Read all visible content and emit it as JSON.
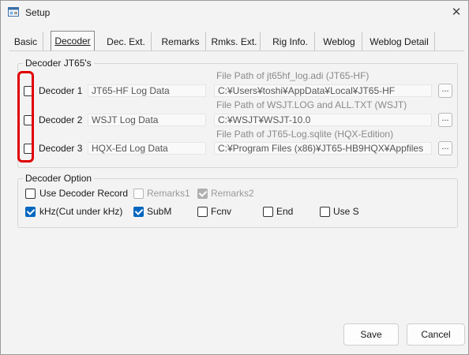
{
  "window": {
    "title": "Setup",
    "app_icon": "setup-window-icon",
    "close_icon": "close-icon",
    "close_glyph": "✕"
  },
  "tabs": [
    {
      "label": "Basic",
      "active": false
    },
    {
      "label": "Decoder",
      "active": true
    },
    {
      "label": "Dec. Ext.",
      "active": false
    },
    {
      "label": "Remarks",
      "active": false
    },
    {
      "label": "Rmks. Ext.",
      "active": false
    },
    {
      "label": "Rig Info.",
      "active": false
    },
    {
      "label": "Weblog",
      "active": false
    },
    {
      "label": "Weblog Detail",
      "active": false
    }
  ],
  "decoder_group": {
    "title": "Decoder JT65's",
    "browse_label": "...",
    "decoders": [
      {
        "label": "Decoder 1",
        "checked": false,
        "name": "JT65-HF Log Data",
        "path_label": "File Path of jt65hf_log.adi (JT65-HF)",
        "path": "C:¥Users¥toshi¥AppData¥Local¥JT65-HF"
      },
      {
        "label": "Decoder 2",
        "checked": false,
        "name": "WSJT Log Data",
        "path_label": "File Path of WSJT.LOG and ALL.TXT (WSJT)",
        "path": "C:¥WSJT¥WSJT-10.0"
      },
      {
        "label": "Decoder 3",
        "checked": false,
        "name": "HQX-Ed Log Data",
        "path_label": "File Path of JT65-Log.sqlite (HQX-Edition)",
        "path": "C:¥Program Files (x86)¥JT65-HB9HQX¥Appfiles"
      }
    ]
  },
  "option_group": {
    "title": "Decoder Option",
    "row1": [
      {
        "label": "Use Decoder Record",
        "checked": false,
        "disabled": false
      },
      {
        "label": "Remarks1",
        "checked": false,
        "disabled": true
      },
      {
        "label": "Remarks2",
        "checked": true,
        "disabled": true
      }
    ],
    "row2": [
      {
        "label": "kHz(Cut under kHz)",
        "checked": true,
        "disabled": false
      },
      {
        "label": "SubM",
        "checked": true,
        "disabled": false
      },
      {
        "label": "Fcnv",
        "checked": false,
        "disabled": false
      },
      {
        "label": "End",
        "checked": false,
        "disabled": false
      },
      {
        "label": "Use S",
        "checked": false,
        "disabled": false
      }
    ]
  },
  "buttons": {
    "save": "Save",
    "cancel": "Cancel"
  },
  "colors": {
    "accent": "#0067c0",
    "highlight": "#e00000"
  }
}
